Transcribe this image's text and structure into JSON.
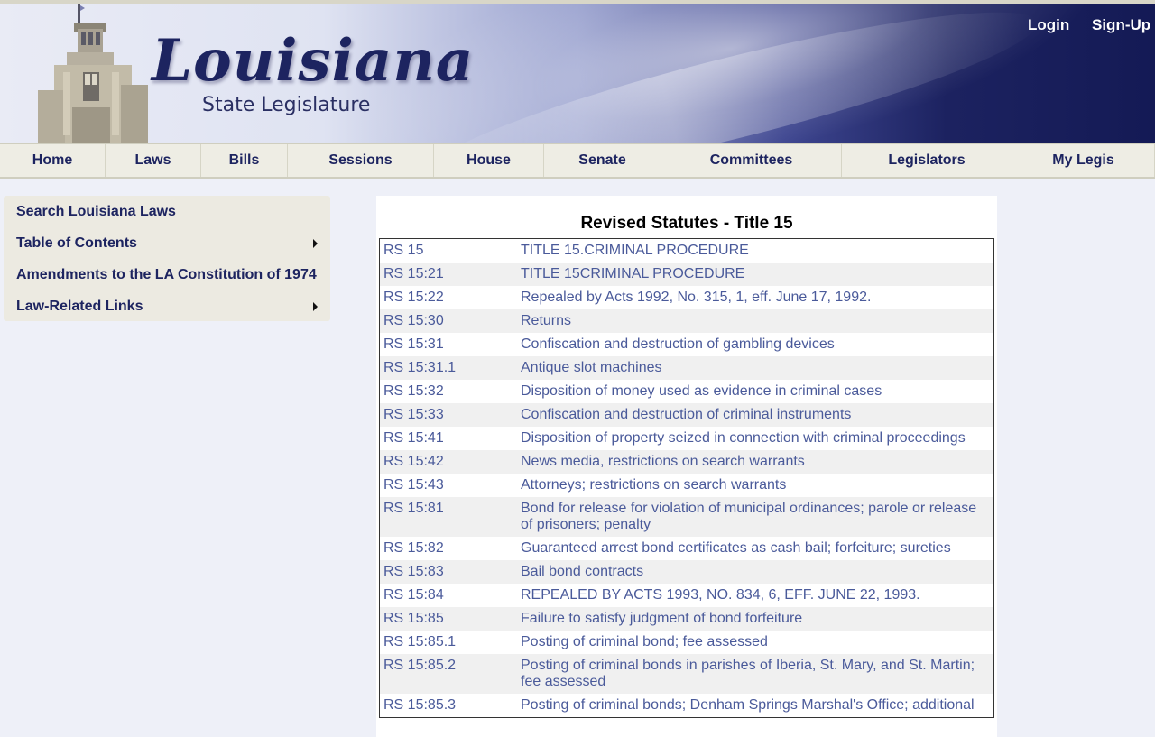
{
  "header": {
    "logo_title": "Louisiana",
    "logo_subtitle": "State Legislature",
    "login": "Login",
    "signup": "Sign-Up"
  },
  "nav": {
    "items": [
      "Home",
      "Laws",
      "Bills",
      "Sessions",
      "House",
      "Senate",
      "Committees",
      "Legislators",
      "My Legis"
    ]
  },
  "sidebar": {
    "items": [
      {
        "label": "Search Louisiana Laws",
        "has_submenu": false
      },
      {
        "label": "Table of Contents",
        "has_submenu": true
      },
      {
        "label": "Amendments to the LA Constitution of 1974",
        "has_submenu": false
      },
      {
        "label": "Law-Related Links",
        "has_submenu": true
      }
    ]
  },
  "main": {
    "title": "Revised Statutes - Title 15",
    "rows": [
      [
        "RS 15",
        "TITLE 15.CRIMINAL PROCEDURE"
      ],
      [
        "RS 15:21",
        "TITLE 15CRIMINAL PROCEDURE"
      ],
      [
        "RS 15:22",
        "Repealed by Acts 1992, No. 315, 1, eff. June 17, 1992."
      ],
      [
        "RS 15:30",
        "Returns"
      ],
      [
        "RS 15:31",
        "Confiscation and destruction of gambling devices"
      ],
      [
        "RS 15:31.1",
        "Antique slot machines"
      ],
      [
        "RS 15:32",
        "Disposition of money used as evidence in criminal cases"
      ],
      [
        "RS 15:33",
        "Confiscation and destruction of criminal instruments"
      ],
      [
        "RS 15:41",
        "Disposition of property seized in connection with criminal proceedings"
      ],
      [
        "RS 15:42",
        "News media, restrictions on search warrants"
      ],
      [
        "RS 15:43",
        "Attorneys; restrictions on search warrants"
      ],
      [
        "RS 15:81",
        "Bond for release for violation of municipal ordinances; parole or release of prisoners; penalty"
      ],
      [
        "RS 15:82",
        "Guaranteed arrest bond certificates as cash bail; forfeiture; sureties"
      ],
      [
        "RS 15:83",
        "Bail bond contracts"
      ],
      [
        "RS 15:84",
        "REPEALED BY ACTS 1993, NO. 834, 6, EFF. JUNE 22, 1993."
      ],
      [
        "RS 15:85",
        "Failure to satisfy judgment of bond forfeiture"
      ],
      [
        "RS 15:85.1",
        "Posting of criminal bond; fee assessed"
      ],
      [
        "RS 15:85.2",
        "Posting of criminal bonds in parishes of Iberia, St. Mary, and St. Martin; fee assessed"
      ],
      [
        "RS 15:85.3",
        "Posting of criminal bonds; Denham Springs Marshal's Office; additional"
      ]
    ]
  },
  "colors": {
    "navy": "#1d2460",
    "link": "#4a5a9a",
    "nav_bg": "#eeede4",
    "page_bg": "#eef0f8"
  }
}
